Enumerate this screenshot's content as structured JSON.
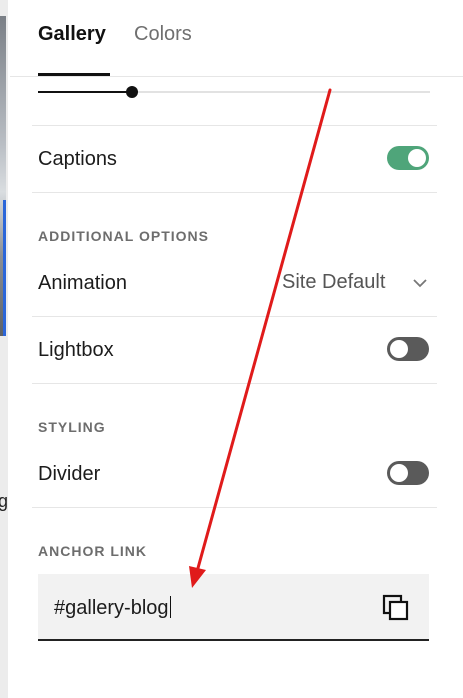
{
  "tabs": [
    {
      "label": "Gallery",
      "active": true
    },
    {
      "label": "Colors",
      "active": false
    }
  ],
  "slider": {
    "value_fraction": 0.24
  },
  "captions": {
    "label": "Captions",
    "toggle_on": true
  },
  "additional_options": {
    "section_label": "ADDITIONAL OPTIONS",
    "animation": {
      "label": "Animation",
      "value": "Site Default"
    },
    "lightbox": {
      "label": "Lightbox",
      "toggle_on": false
    }
  },
  "styling": {
    "section_label": "STYLING",
    "divider": {
      "label": "Divider",
      "toggle_on": false
    }
  },
  "anchor_link": {
    "section_label": "ANCHOR LINK",
    "value": "#gallery-blog"
  },
  "background_partial_text": "g",
  "colors": {
    "accent_green": "#4fa57a",
    "toggle_off": "#5a5a5a",
    "annotation_red": "#e01b1b"
  },
  "icons": [
    "chevron-down-icon",
    "copy-icon",
    "red-arrow-annotation"
  ]
}
